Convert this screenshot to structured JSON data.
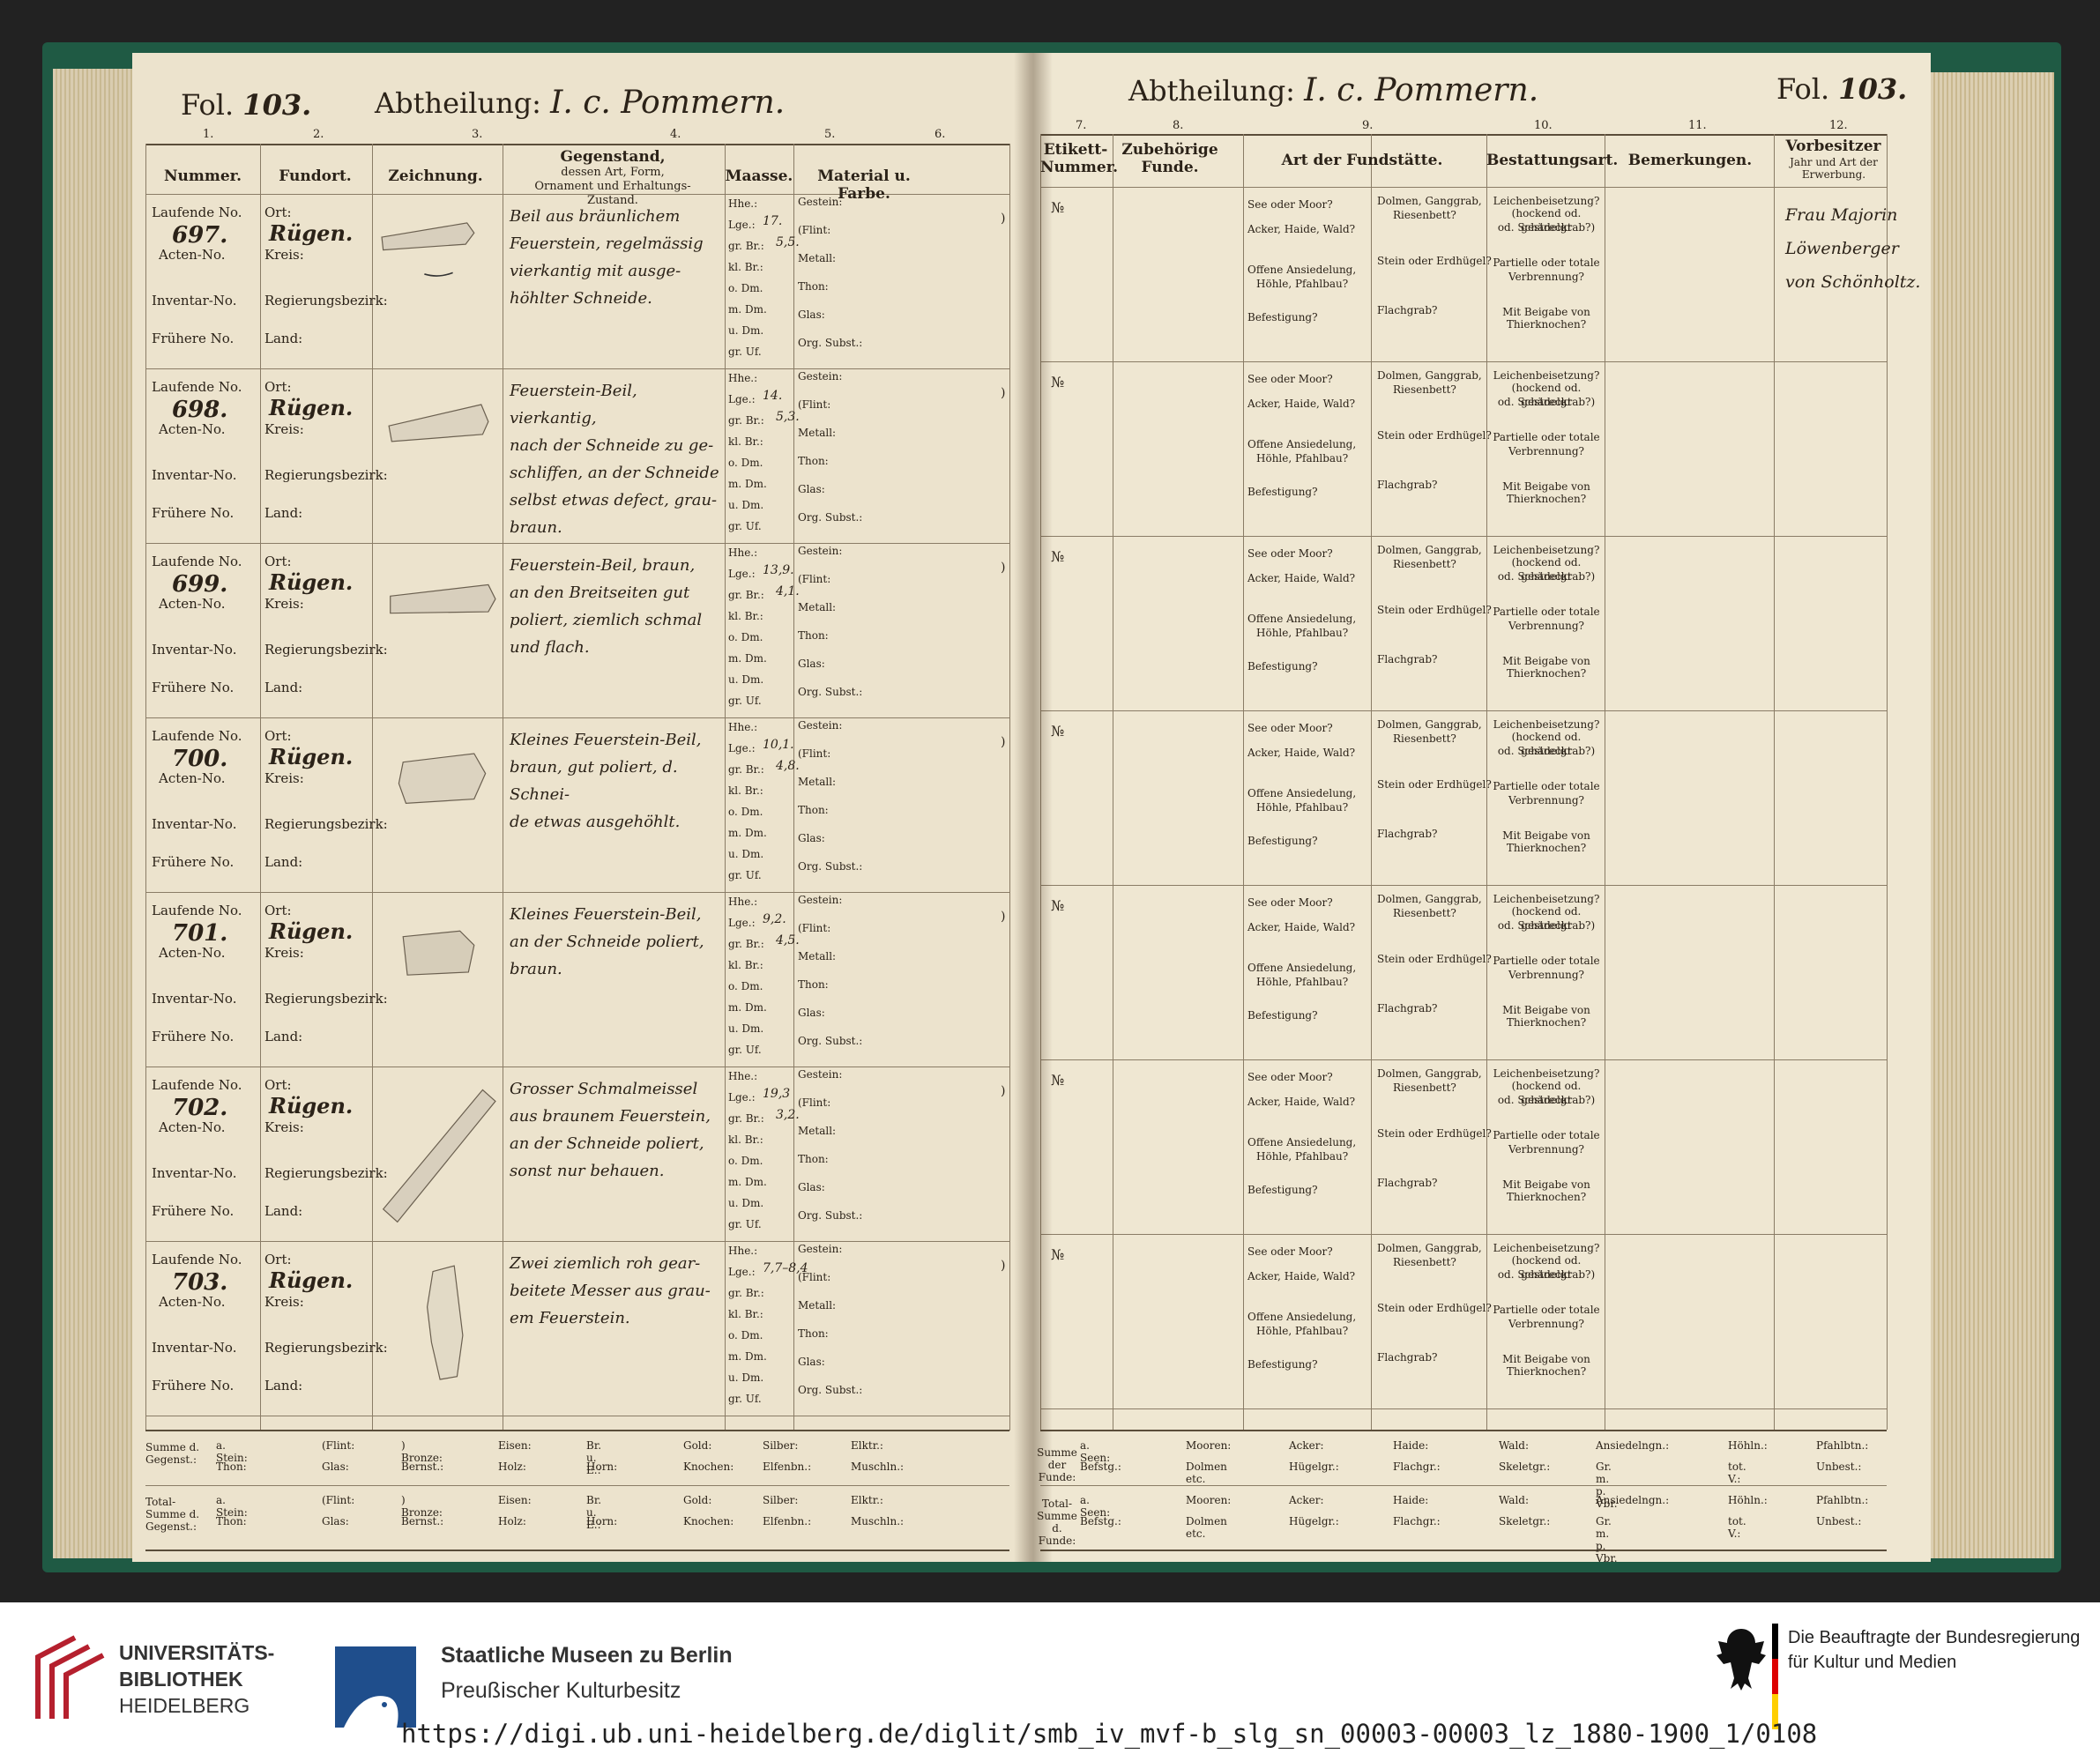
{
  "left_page": {
    "fol_label": "Fol.",
    "fol_number": "103.",
    "abtheilung_label": "Abtheilung:",
    "abtheilung_value": "I. c. Pommern.",
    "column_numbers": [
      "1.",
      "2.",
      "3.",
      "4.",
      "5.",
      "6."
    ],
    "column_headers": {
      "nummer": "Nummer.",
      "fundort": "Fundort.",
      "zeichnung": "Zeichnung.",
      "gegenstand": "Gegenstand,",
      "gegenstand_sub": "dessen Art, Form, Ornament und Erhaltungs-Zustand.",
      "maasse": "Maasse.",
      "material": "Material u. Farbe."
    },
    "row_labels": {
      "laufende": "Laufende No.",
      "acten": "Acten-No.",
      "inventar": "Inventar-No.",
      "fruehere": "Frühere No.",
      "ort": "Ort:",
      "kreis": "Kreis:",
      "regbez": "Regierungsbezirk:",
      "land": "Land:"
    },
    "maasse_labels": [
      "Hhe.:",
      "Lge.:",
      "gr. Br.:",
      "kl. Br.:",
      "o. Dm.",
      "m. Dm.",
      "u. Dm.",
      "gr. Uf."
    ],
    "material_labels": [
      "Gestein:",
      "(Flint:",
      "Metall:",
      "Thon:",
      "Glas:",
      "Org. Subst.:"
    ],
    "entries": [
      {
        "number": "697.",
        "ort": "Rügen.",
        "desc": [
          "Beil aus bräunlichem",
          "Feuerstein, regelmässig",
          "vierkantig mit ausge-",
          "höhlter Schneide."
        ],
        "lge": "17.",
        "gr_br": "5,5."
      },
      {
        "number": "698.",
        "ort": "Rügen.",
        "desc": [
          "Feuerstein-Beil, vierkantig,",
          "nach der Schneide zu ge-",
          "schliffen, an der Schneide",
          "selbst etwas defect, grau-",
          "braun."
        ],
        "lge": "14.",
        "gr_br": "5,3."
      },
      {
        "number": "699.",
        "ort": "Rügen.",
        "desc": [
          "Feuerstein-Beil, braun,",
          "an den Breitseiten gut",
          "poliert, ziemlich schmal",
          "und flach."
        ],
        "lge": "13,9.",
        "gr_br": "4,1."
      },
      {
        "number": "700.",
        "ort": "Rügen.",
        "desc": [
          "Kleines Feuerstein-Beil,",
          "braun, gut poliert, d. Schnei-",
          "de etwas ausgehöhlt."
        ],
        "lge": "10,1.",
        "gr_br": "4,8."
      },
      {
        "number": "701.",
        "ort": "Rügen.",
        "desc": [
          "Kleines Feuerstein-Beil,",
          "an der Schneide poliert, braun."
        ],
        "lge": "9,2.",
        "gr_br": "4,5."
      },
      {
        "number": "702.",
        "ort": "Rügen.",
        "desc": [
          "Grosser Schmalmeissel",
          "aus braunem Feuerstein,",
          "an der Schneide poliert,",
          "sonst nur behauen."
        ],
        "lge": "19,3",
        "gr_br": "3,2."
      },
      {
        "number": "703.",
        "ort": "Rügen.",
        "desc": [
          "Zwei ziemlich roh gear-",
          "beitete Messer aus grau-",
          "em Feuerstein."
        ],
        "lge": "7,7–8,4",
        "gr_br": ""
      }
    ],
    "summe": {
      "row1_label": "Summe d.",
      "row1_label2": "Gegenst.:",
      "row2_label": "Total-",
      "row2_label2": "Summe d.",
      "row2_label3": "Gegenst.:",
      "top": [
        "a. Stein:",
        "(Flint:",
        ") Bronze:",
        "Eisen:",
        "Br. u. E.:",
        "Gold:",
        "Silber:",
        "Elktr.:"
      ],
      "bottom": [
        "Thon:",
        "Glas:",
        "Bernst.:",
        "Holz:",
        "Horn:",
        "Knochen:",
        "Elfenbn.:",
        "Muschln.:"
      ]
    }
  },
  "right_page": {
    "abtheilung_label": "Abtheilung:",
    "abtheilung_value": "I. c. Pommern.",
    "fol_label": "Fol.",
    "fol_number": "103.",
    "column_numbers": [
      "7.",
      "8.",
      "9.",
      "10.",
      "11.",
      "12."
    ],
    "column_headers": {
      "etikett": "Etikett-",
      "etikett2": "Nummer.",
      "zubehoerige": "Zubehörige",
      "zubehoerige2": "Funde.",
      "art": "Art der Fundstätte.",
      "bestattung": "Bestattungsart.",
      "bemerkungen": "Bemerkungen.",
      "vorbesitzer": "Vorbesitzer",
      "vorbesitzer_sub": "Jahr und Art der Erwerbung."
    },
    "etikett_mark": "№",
    "art_labels": [
      "See oder Moor?",
      "Acker, Haide, Wald?",
      "Offene Ansiedelung,",
      "Höhle, Pfahlbau?",
      "Befestigung?"
    ],
    "art2_labels": [
      "Dolmen, Ganggrab,",
      "Riesenbett?",
      "Stein oder Erdhügel?",
      "Flachgrab?"
    ],
    "bestattung_labels": [
      "Leichenbeisetzung?",
      "(hockend od. gestreckt",
      "od. Schädelgrab?)",
      "Partielle oder totale",
      "Verbrennung?",
      "Mit Beigabe von",
      "Thierknochen?"
    ],
    "vorbesitzer_text": [
      "Frau Majorin",
      "Löwenberger",
      "von Schönholtz."
    ],
    "summe": {
      "row1_label": "Summe der Funde:",
      "row2_label": "Total-Summe d. Funde:",
      "top": [
        "a. Seen:",
        "Mooren:",
        "Acker:",
        "Haide:",
        "Wald:",
        "Ansiedelngn.:",
        "Höhln.:",
        "Pfahlbtn.:"
      ],
      "bottom": [
        "Befstg.:",
        "Dolmen etc.",
        "Hügelgr.:",
        "Flachgr.:",
        "Skeletgr.:",
        "Gr. m. p. Vbr.",
        "tot. V.:",
        "Unbest.:"
      ]
    }
  },
  "footer": {
    "uni_line1": "UNIVERSITÄTS-",
    "uni_line2": "BIBLIOTHEK",
    "uni_line3": "HEIDELBERG",
    "smb_line1": "Staatliche Museen zu Berlin",
    "smb_line2": "Preußischer Kulturbesitz",
    "bkm_line1": "Die Beauftragte der Bundesregierung",
    "bkm_line2": "für Kultur und Medien",
    "url": "https://digi.ub.uni-heidelberg.de/diglit/smb_iv_mvf-b_slg_sn_00003-00003_lz_1880-1900_1/0108",
    "colors": {
      "uni_red": "#b5202e",
      "smb_blue": "#1f4e8c",
      "text": "#333333"
    }
  }
}
